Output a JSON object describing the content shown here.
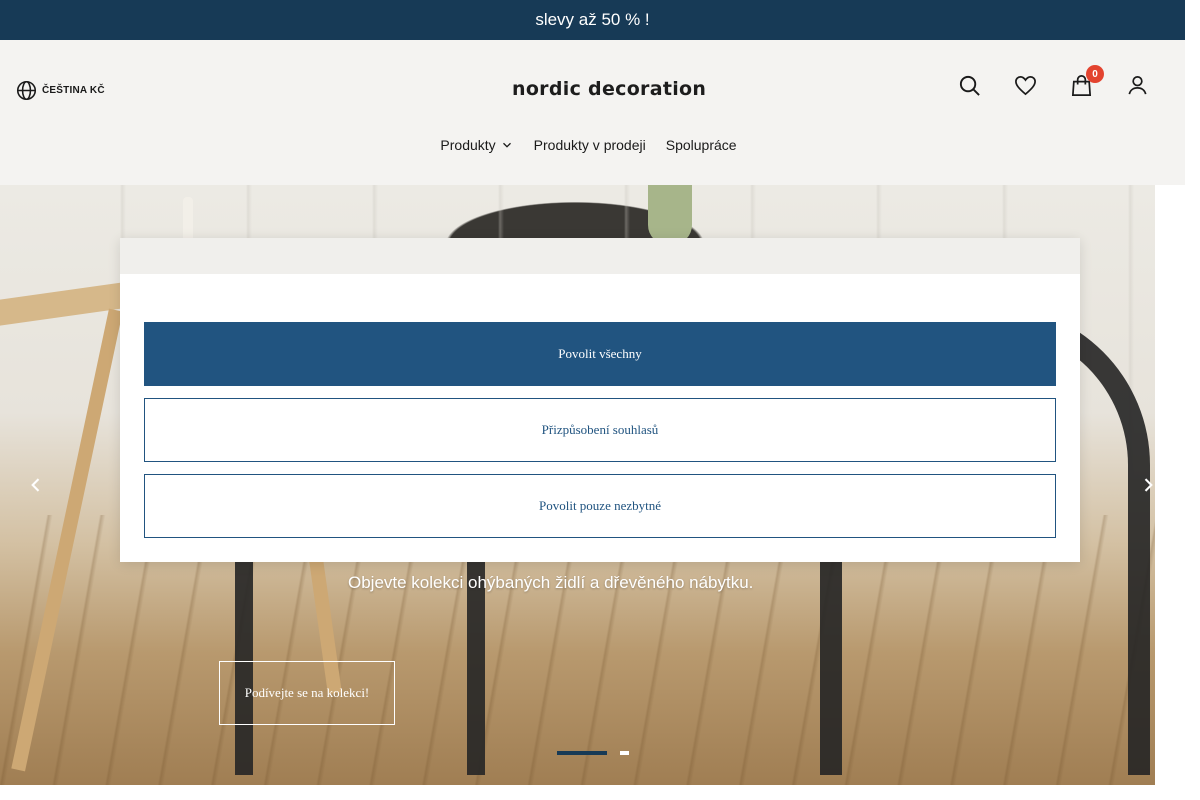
{
  "promo": {
    "text": "slevy až 50 % !"
  },
  "header": {
    "language_label": "ČEŠTINA KČ",
    "logo": "nordic decoration",
    "cart_count": "0",
    "nav": [
      {
        "label": "Produkty"
      },
      {
        "label": "Produkty v prodeji"
      },
      {
        "label": "Spolupráce"
      }
    ]
  },
  "hero": {
    "subtitle": "Objevte kolekci ohýbaných židlí a dřevěného nábytku.",
    "cta_label": "Podívejte se na kolekci!",
    "slides_total": 2,
    "active_slide": 1
  },
  "cookie_modal": {
    "accept_all_label": "Povolit všechny",
    "customize_label": "Přizpůsobení souhlasů",
    "necessary_only_label": "Povolit pouze nezbytné"
  },
  "colors": {
    "promo_bg": "#173a56",
    "primary_button": "#215480",
    "badge": "#e3432f",
    "header_bg": "#f4f3f1"
  }
}
